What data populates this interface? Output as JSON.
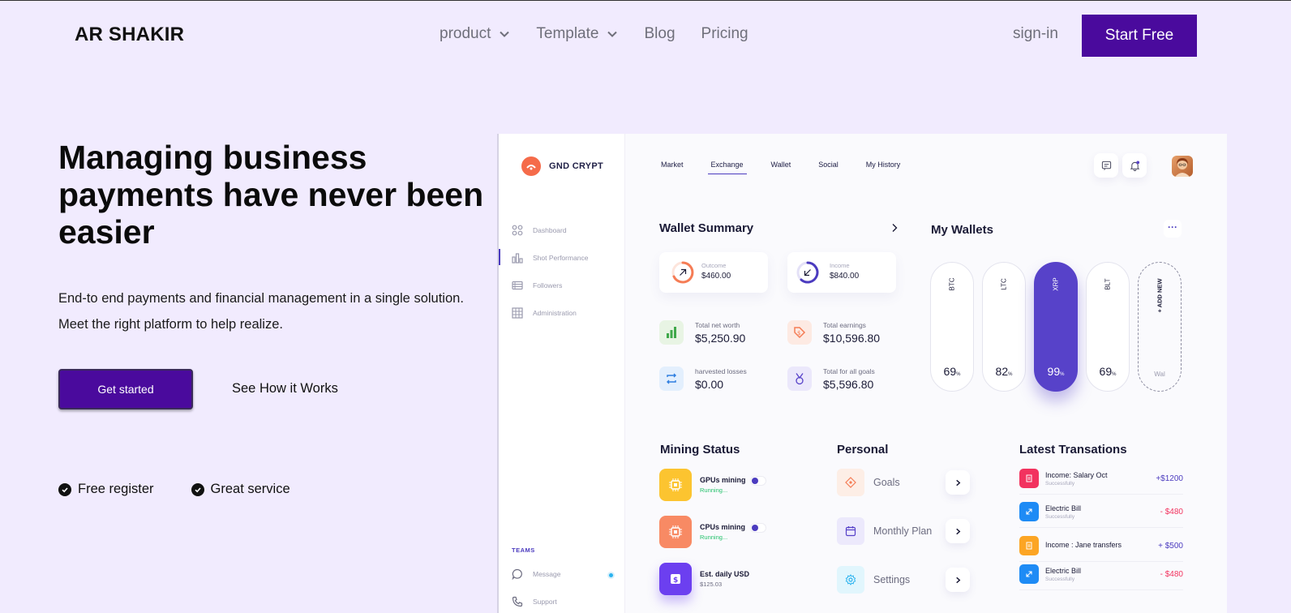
{
  "nav": {
    "logo": "AR SHAKIR",
    "links": [
      "product",
      "Template",
      "Blog",
      "Pricing"
    ],
    "signin": "sign-in",
    "cta": "Start Free"
  },
  "hero": {
    "title": "Managing business payments have never been easier",
    "sub_line1": "End-to end payments and financial management in a single solution.",
    "sub_line2": "Meet the right platform to help realize.",
    "primary_btn": "Get started",
    "secondary_btn": "See How it Works",
    "checks": [
      "Free register",
      "Great service"
    ]
  },
  "dashboard": {
    "brand": "GND CRYPT",
    "sidebar": [
      "Dashboard",
      "Shot Performance",
      "Followers",
      "Administration"
    ],
    "teams_label": "TEAMS",
    "teams": [
      "Message",
      "Support"
    ],
    "tabs": [
      "Market",
      "Exchange",
      "Wallet",
      "Social",
      "My History"
    ],
    "wallet_summary": {
      "title": "Wallet Summary",
      "outcome_label": "Outcome",
      "outcome": "$460.00",
      "income_label": "Income",
      "income": "$840.00",
      "stats": [
        {
          "label": "Total net worth",
          "value": "$5,250.90"
        },
        {
          "label": "Total earnings",
          "value": "$10,596.80"
        },
        {
          "label": "harvested losses",
          "value": "$0.00"
        },
        {
          "label": "Total for all goals",
          "value": "$5,596.80"
        }
      ]
    },
    "my_wallets": {
      "title": "My Wallets",
      "more": "···",
      "items": [
        {
          "name": "BTC",
          "pct": "69"
        },
        {
          "name": "LTC",
          "pct": "82"
        },
        {
          "name": "XRP",
          "pct": "99"
        },
        {
          "name": "BLT",
          "pct": "69"
        }
      ],
      "pct_sign": "%",
      "add_label": "+ ADD NEW",
      "add_sub": "Wal"
    },
    "mining": {
      "title": "Mining Status",
      "items": [
        {
          "name": "GPUs mining",
          "sub": "Running..."
        },
        {
          "name": "CPUs mining",
          "sub": "Running..."
        },
        {
          "name": "Est. daily USD",
          "sub": "$125.03"
        }
      ]
    },
    "personal": {
      "title": "Personal",
      "items": [
        "Goals",
        "Monthly Plan",
        "Settings"
      ]
    },
    "transactions": {
      "title": "Latest Transations",
      "items": [
        {
          "name": "Income: Salary Oct",
          "sub": "Successfully",
          "amount": "+$1200"
        },
        {
          "name": "Electric Bill",
          "sub": "Successfully",
          "amount": "- $480"
        },
        {
          "name": "Income : Jane transfers",
          "sub": "",
          "amount": "+ $500"
        },
        {
          "name": "Electric Bill",
          "sub": "Successfully",
          "amount": "- $480"
        }
      ]
    }
  },
  "colors": {
    "page_bg": "#f1ebfe",
    "brand_purple": "#4a0a9d",
    "accent": "#5742c9",
    "positive": "#4b3bbf",
    "negative": "#f2335f"
  }
}
